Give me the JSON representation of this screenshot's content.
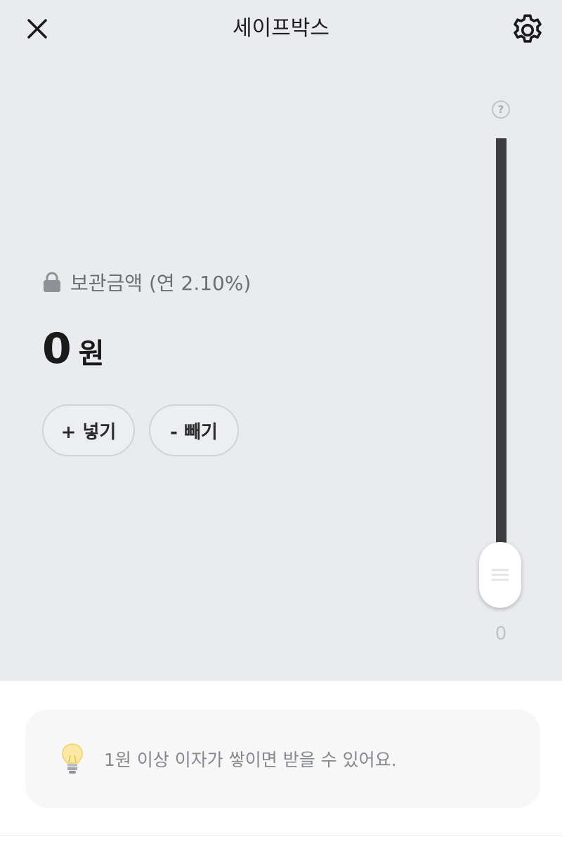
{
  "header": {
    "title": "세이프박스",
    "close_icon": "close-icon",
    "settings_icon": "gear-icon"
  },
  "slider": {
    "help_label": "?",
    "value_label": "0",
    "level": 0
  },
  "balance": {
    "lock_icon": "lock-icon",
    "label": "보관금액 (연 2.10%)",
    "amount": "0",
    "unit": "원"
  },
  "actions": {
    "add_label": "+ 넣기",
    "withdraw_label": "- 빼기"
  },
  "tip": {
    "icon": "lightbulb-icon",
    "text": "1원 이상 이자가 쌓이면 받을 수 있어요."
  },
  "colors": {
    "background": "#e9ebee",
    "track": "#3d3d3f",
    "card": "#f7f7f8"
  }
}
